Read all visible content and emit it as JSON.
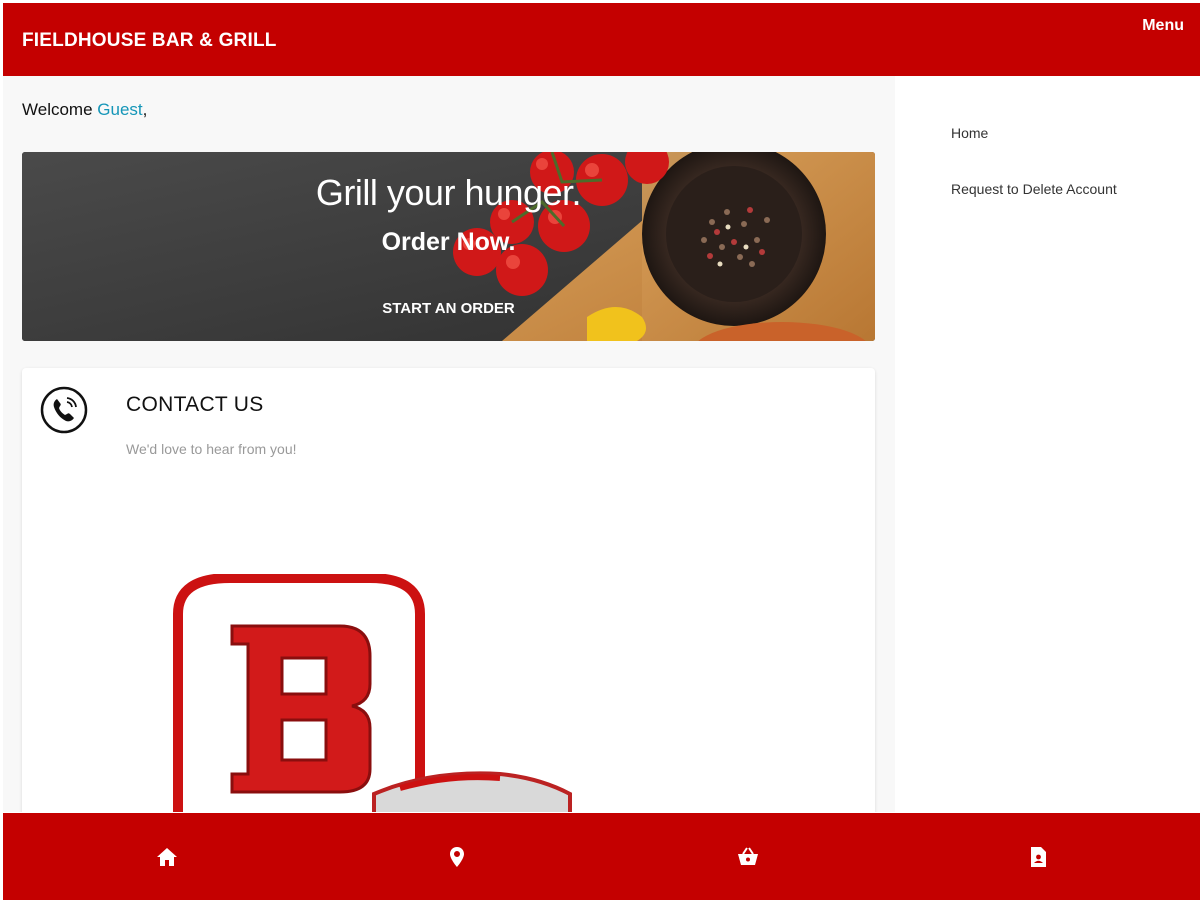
{
  "header": {
    "brand": "FIELDHOUSE BAR & GRILL",
    "menu_label": "Menu"
  },
  "welcome": {
    "prefix": "Welcome ",
    "name": "Guest",
    "suffix": ","
  },
  "hero": {
    "title": "Grill your hunger.",
    "subtitle": "Order Now.",
    "cta": "START AN ORDER"
  },
  "contact": {
    "title": "CONTACT US",
    "subtitle": "We'd love to hear from you!",
    "icon": "phone-icon"
  },
  "sidebar": {
    "items": [
      {
        "label": "Home"
      },
      {
        "label": "Request to Delete Account"
      }
    ]
  },
  "bottom_nav": {
    "items": [
      {
        "icon": "home-icon"
      },
      {
        "icon": "location-pin-icon"
      },
      {
        "icon": "basket-icon"
      },
      {
        "icon": "receipt-icon"
      }
    ]
  },
  "colors": {
    "brand_red": "#c40000",
    "accent_link": "#1596b8",
    "page_bg": "#f8f8f8"
  }
}
